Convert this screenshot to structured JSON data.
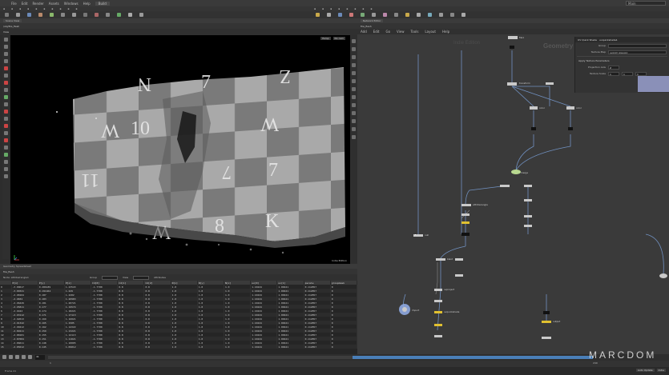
{
  "menubar": {
    "items": [
      "File",
      "Edit",
      "Render",
      "Assets",
      "Windows",
      "Help"
    ],
    "tab_label": "Build",
    "right_field": "Main"
  },
  "left_pane": {
    "tab_label": "Scene View",
    "path": "/obj/fire_flesh",
    "view_label": "View",
    "persp_label": "Persp",
    "cam_label": "No cam",
    "corner_label": "Indie Edition"
  },
  "spreadsheet": {
    "tab_label": "Geometry Spreadsheet",
    "path": "fire_flesh",
    "node_label": "Node: attribwrangle1",
    "group_label": "Group",
    "view_label": "View",
    "attributes_label": "Attributes",
    "columns": [
      "",
      "P[x]",
      "P[y]",
      "P[z]",
      "Cd[0]",
      "Cd[1]",
      "Cd[2]",
      "N[x]",
      "N[y]",
      "N[z]",
      "uv[0]",
      "uv[1]",
      "pscale",
      "groupmask"
    ],
    "rows": [
      [
        "0",
        "-3.00617",
        "0.286189",
        "1.23543",
        "-1.7700",
        "0.8",
        "0.8",
        "1.0",
        "1.0",
        "1.0",
        "1.10424",
        "1.00421",
        "0.112857",
        "0"
      ],
      [
        "1",
        "-3.00321",
        "0.191464",
        "1.229",
        "-1.7700",
        "0.8",
        "0.8",
        "1.0",
        "1.0",
        "1.0",
        "1.10424",
        "1.00421",
        "0.112857",
        "0"
      ],
      [
        "2",
        "-2.98164",
        "0.187",
        "1.2202",
        "-1.7700",
        "0.8",
        "0.8",
        "1.0",
        "1.0",
        "1.0",
        "1.10424",
        "1.00421",
        "0.112857",
        "0"
      ],
      [
        "3",
        "-2.9832",
        "0.183",
        "1.20983",
        "-1.7700",
        "0.8",
        "0.8",
        "1.0",
        "1.0",
        "1.0",
        "1.10424",
        "1.00421",
        "0.112857",
        "0"
      ],
      [
        "4",
        "-2.96429",
        "0.181",
        "1.20721",
        "-1.7700",
        "0.8",
        "0.8",
        "1.0",
        "1.0",
        "1.0",
        "1.10424",
        "1.00421",
        "0.112857",
        "0"
      ],
      [
        "5",
        "-2.95811",
        "0.177",
        "1.19574",
        "-1.7700",
        "0.8",
        "0.8",
        "1.0",
        "1.0",
        "1.0",
        "1.10424",
        "1.00421",
        "0.112857",
        "0"
      ],
      [
        "6",
        "-2.9422",
        "0.174",
        "1.18221",
        "-1.7700",
        "0.8",
        "0.8",
        "1.0",
        "1.0",
        "1.0",
        "1.10424",
        "1.00421",
        "0.112857",
        "0"
      ],
      [
        "7",
        "-2.93112",
        "0.171",
        "1.17113",
        "-1.7700",
        "0.8",
        "0.8",
        "1.0",
        "1.0",
        "1.0",
        "1.10424",
        "1.00421",
        "0.112857",
        "0"
      ],
      [
        "8",
        "-2.92013",
        "0.169",
        "1.16021",
        "-1.7700",
        "0.8",
        "0.8",
        "1.0",
        "1.0",
        "1.0",
        "1.10424",
        "1.00421",
        "0.112857",
        "0"
      ],
      [
        "9",
        "-2.91342",
        "0.165",
        "1.1505",
        "-1.7700",
        "0.8",
        "0.8",
        "1.0",
        "1.0",
        "1.0",
        "1.10424",
        "1.00421",
        "0.112857",
        "0"
      ],
      [
        "10",
        "-2.90412",
        "0.162",
        "1.14322",
        "-1.7700",
        "0.8",
        "0.8",
        "1.0",
        "1.0",
        "1.0",
        "1.10424",
        "1.00421",
        "0.112857",
        "0"
      ],
      [
        "11",
        "-2.89211",
        "0.159",
        "1.13221",
        "-1.7700",
        "0.8",
        "0.8",
        "1.0",
        "1.0",
        "1.0",
        "1.10424",
        "1.00421",
        "0.112857",
        "0"
      ],
      [
        "12",
        "-2.88101",
        "0.155",
        "1.12113",
        "-1.7700",
        "0.8",
        "0.8",
        "1.0",
        "1.0",
        "1.0",
        "1.10424",
        "1.00421",
        "0.112857",
        "0"
      ],
      [
        "13",
        "-2.87004",
        "0.151",
        "1.11021",
        "-1.7700",
        "0.8",
        "0.8",
        "1.0",
        "1.0",
        "1.0",
        "1.10424",
        "1.00421",
        "0.112857",
        "0"
      ],
      [
        "14",
        "-2.86011",
        "0.148",
        "1.10005",
        "-1.7700",
        "0.8",
        "0.8",
        "1.0",
        "1.0",
        "1.0",
        "1.10424",
        "1.00421",
        "0.112857",
        "0"
      ],
      [
        "15",
        "-2.85012",
        "0.145",
        "1.09012",
        "-1.7700",
        "0.8",
        "0.8",
        "1.0",
        "1.0",
        "1.0",
        "1.10424",
        "1.00421",
        "0.112857",
        "0"
      ]
    ]
  },
  "network": {
    "tab_label": "Network Editor",
    "path": "fire_flesh",
    "menu": [
      "Add",
      "Edit",
      "Go",
      "View",
      "Tools",
      "Layout",
      "Help"
    ],
    "context_label": "Geometry",
    "context_label2": "Indie Edition"
  },
  "params": {
    "title": "UV Quick Shade",
    "node_name": "uvquickshade1",
    "rows": [
      {
        "label": "Group",
        "value": ""
      },
      {
        "label": "Texture Map",
        "value": "uvgrid_grey.pic"
      }
    ],
    "section": "Apply Texture Parameters",
    "rows2": [
      {
        "label": "Projection Axis",
        "value": "Z"
      },
      {
        "label": "Texture Scale",
        "value": "1"
      }
    ]
  },
  "timeline": {
    "frame": "41",
    "start": "1",
    "end": "240"
  },
  "status": {
    "left": "Frame 41",
    "right_a": "Auto Update",
    "right_b": "Indie"
  },
  "watermark": "MARCDOM",
  "colors": {
    "accent_blue": "#4a7fb8",
    "node_yellow": "#e0c030",
    "node_green": "#b8d890",
    "node_blue": "#8ea8e0"
  }
}
